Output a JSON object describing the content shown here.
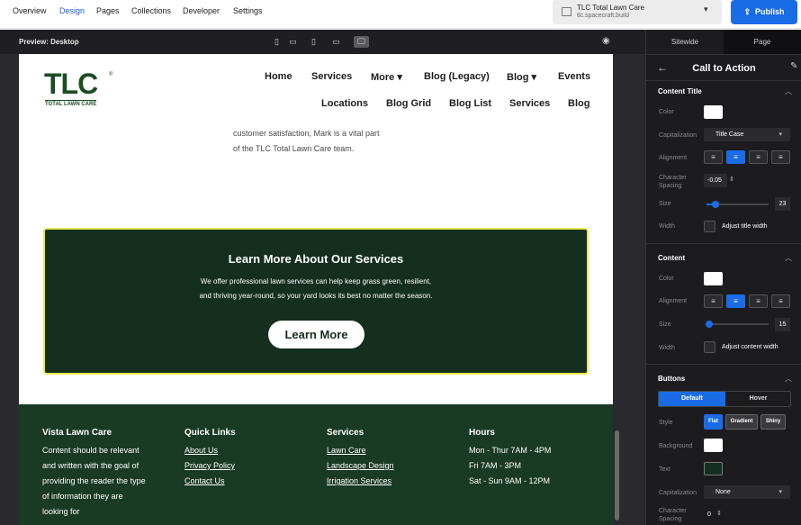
{
  "topnav": {
    "tabs": [
      "Overview",
      "Design",
      "Pages",
      "Collections",
      "Developer",
      "Settings"
    ],
    "active": "Design"
  },
  "site_selector": {
    "name": "TLC Total Lawn Care",
    "domain": "tlc.spacecraft.build"
  },
  "publish_label": "Publish",
  "preview": {
    "label": "Preview: Desktop"
  },
  "site": {
    "logo": {
      "main": "TLC",
      "reg": "®",
      "sub": "TOTAL LAWN CARE"
    },
    "menu_row1": [
      "Home",
      "Services",
      "More",
      "Blog (Legacy)",
      "Blog",
      "Events"
    ],
    "menu_row2": [
      "Locations",
      "Blog Grid",
      "Blog List",
      "Services",
      "Blog"
    ],
    "about_lines": [
      "customer satisfaction, Mark is a vital part",
      "of the TLC Total Lawn Care team."
    ],
    "cta": {
      "title": "Learn More About Our Services",
      "body1": "We offer professional lawn services can help keep grass green, resilient,",
      "body2": "and thriving year-round, so your yard looks its best no matter the season.",
      "button": "Learn More"
    },
    "footer": {
      "col1": {
        "title": "Vista Lawn Care",
        "lines": [
          "Content should be relevant",
          "and written with the goal of",
          "providing the reader the type",
          "of information they are",
          "looking for"
        ]
      },
      "col2": {
        "title": "Quick Links",
        "links": [
          "About Us",
          "Privacy Policy",
          "Contact Us"
        ]
      },
      "col3": {
        "title": "Services",
        "links": [
          "Lawn Care",
          "Landscape Design",
          "Irrigation Services"
        ]
      },
      "col4": {
        "title": "Hours",
        "lines": [
          "Mon - Thur 7AM - 4PM",
          "Fri 7AM - 3PM",
          "Sat - Sun 9AM - 12PM"
        ]
      }
    }
  },
  "panel": {
    "tabs": [
      "Sitewide",
      "Page"
    ],
    "active_tab": "Page",
    "title": "Call to Action",
    "content_title": {
      "heading": "Content Title",
      "color_label": "Color",
      "capitalization_label": "Capitalization",
      "capitalization_value": "Title Case",
      "alignment_label": "Alignment",
      "spacing_label1": "Character",
      "spacing_label2": "Spacing",
      "spacing_value": "-0.05",
      "size_label": "Size",
      "size_value": "23",
      "size_fraction": 0.12,
      "width_label": "Width",
      "width_check_label": "Adjust title width"
    },
    "content": {
      "heading": "Content",
      "color_label": "Color",
      "alignment_label": "Alignment",
      "size_label": "Size",
      "size_value": "15",
      "size_fraction": 0.02,
      "width_label": "Width",
      "width_check_label": "Adjust content width"
    },
    "buttons": {
      "heading": "Buttons",
      "tabs": [
        "Default",
        "Hover"
      ],
      "style_label": "Style",
      "styles": [
        "Flat",
        "Gradient",
        "Shiny"
      ],
      "background_label": "Background",
      "text_label": "Text",
      "capitalization_label": "Capitalization",
      "capitalization_value": "None",
      "spacing_label1": "Character",
      "spacing_label2": "Spacing",
      "spacing_value": "0"
    },
    "colors": {
      "white": "#ffffff",
      "dark_green": "#142e1f",
      "accent": "#1a6ce6"
    }
  }
}
